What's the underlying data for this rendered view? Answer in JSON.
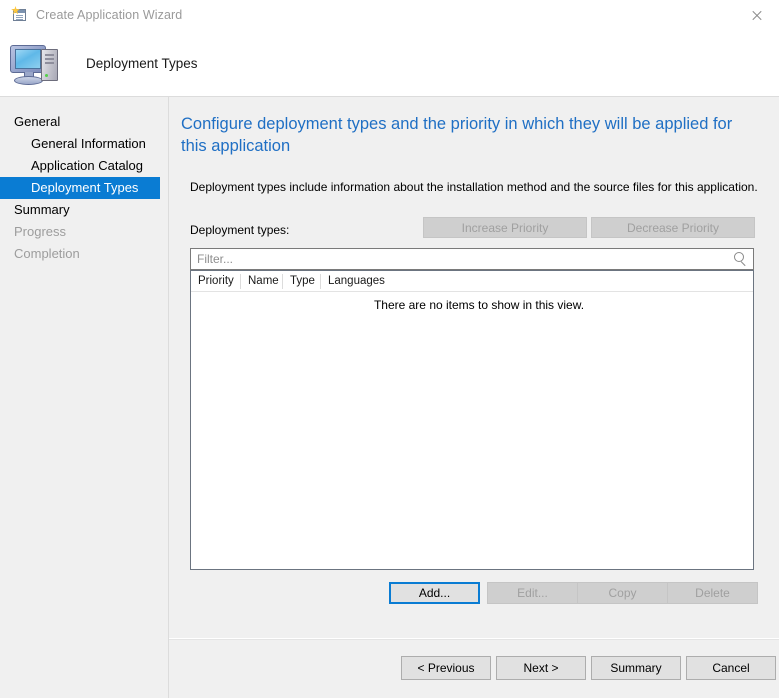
{
  "window": {
    "title": "Create Application Wizard",
    "icon": "new-document-icon",
    "close_icon": "close-icon"
  },
  "header": {
    "icon": "computer-icon",
    "title": "Deployment Types"
  },
  "sidebar": {
    "items": [
      {
        "label": "General",
        "level": 0,
        "state": "normal"
      },
      {
        "label": "General Information",
        "level": 1,
        "state": "normal"
      },
      {
        "label": "Application Catalog",
        "level": 1,
        "state": "normal"
      },
      {
        "label": "Deployment Types",
        "level": 1,
        "state": "selected"
      },
      {
        "label": "Summary",
        "level": 0,
        "state": "normal"
      },
      {
        "label": "Progress",
        "level": 0,
        "state": "disabled"
      },
      {
        "label": "Completion",
        "level": 0,
        "state": "disabled"
      }
    ]
  },
  "main": {
    "page_title": "Configure deployment types and the priority in which they will be applied for this application",
    "description": "Deployment types include information about the installation method and the source files for this application.",
    "deployment_types_label": "Deployment types:",
    "increase_priority_label": "Increase Priority",
    "decrease_priority_label": "Decrease Priority",
    "filter_placeholder": "Filter...",
    "search_icon": "search-icon",
    "table": {
      "columns": [
        "Priority",
        "Name",
        "Type",
        "Languages"
      ],
      "rows": [],
      "empty_message": "There are no items to show in this view."
    },
    "add_label": "Add...",
    "edit_label": "Edit...",
    "copy_label": "Copy",
    "delete_label": "Delete"
  },
  "footer": {
    "previous_label": "< Previous",
    "next_label": "Next >",
    "summary_label": "Summary",
    "cancel_label": "Cancel"
  },
  "colors": {
    "accent_blue": "#0a7cd3",
    "title_blue": "#1f6fc4",
    "body_gray": "#f0f0f0",
    "disabled_text": "#a0a0a0"
  }
}
